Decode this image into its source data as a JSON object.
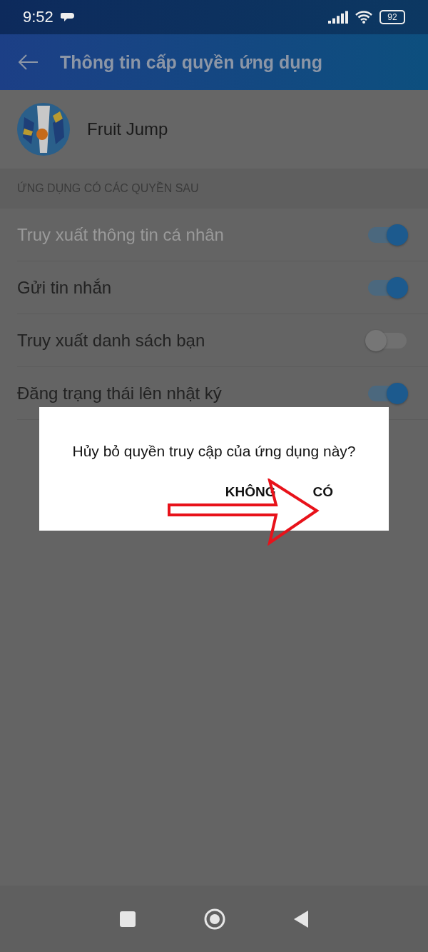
{
  "status_bar": {
    "time": "9:52",
    "battery": "92"
  },
  "app_bar": {
    "title": "Thông tin cấp quyền ứng dụng"
  },
  "app": {
    "name": "Fruit Jump"
  },
  "section_header": "ỨNG DỤNG CÓ CÁC QUYỀN SAU",
  "permissions": [
    {
      "label": "Truy xuất thông tin cá nhân",
      "on": true,
      "disabled": true
    },
    {
      "label": "Gửi tin nhắn",
      "on": true,
      "disabled": false
    },
    {
      "label": "Truy xuất danh sách bạn",
      "on": false,
      "disabled": false
    },
    {
      "label": "Đăng trạng thái lên nhật ký",
      "on": true,
      "disabled": false
    }
  ],
  "dialog": {
    "message": "Hủy bỏ quyền truy cập của ứng dụng này?",
    "buttons": [
      "KHÔNG",
      "CÓ"
    ]
  }
}
